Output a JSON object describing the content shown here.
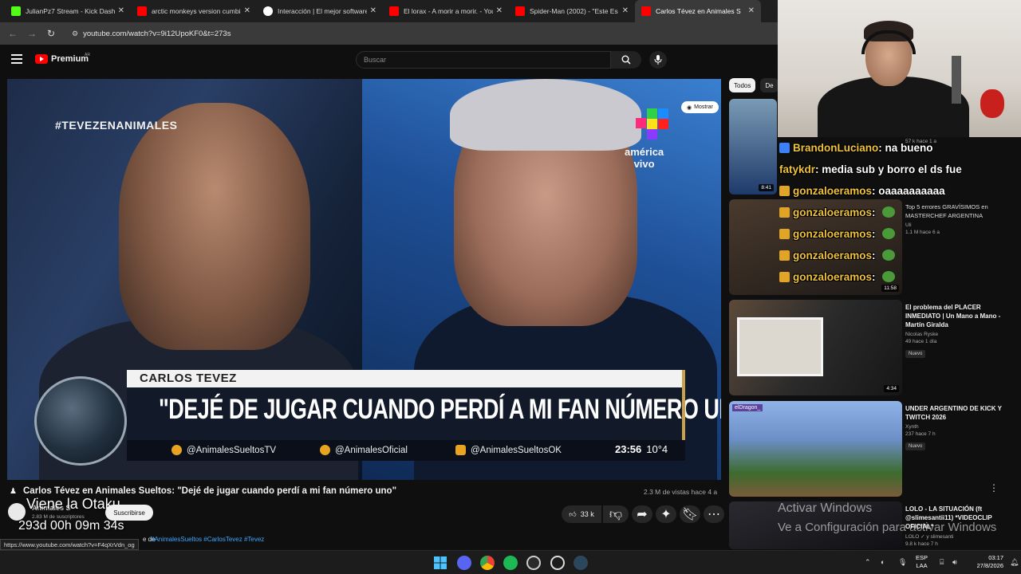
{
  "browser": {
    "tabs": [
      {
        "title": "JulianPz7 Stream - Kick Dashbo",
        "favicon_color": "#53fc18",
        "active": false
      },
      {
        "title": "arctic monkeys version cumbia",
        "favicon_color": "#ff0000",
        "active": false
      },
      {
        "title": "Interacción | El mejor software",
        "favicon_color": "#ffffff",
        "active": false
      },
      {
        "title": "El lorax - A morir a morir. - You",
        "favicon_color": "#ff0000",
        "active": false
      },
      {
        "title": "Spider-Man (2002) - \"Este Es M",
        "favicon_color": "#ff0000",
        "active": false
      },
      {
        "title": "Carlos Tévez en Animales S",
        "favicon_color": "#ff0000",
        "active": true
      }
    ],
    "url": "youtube.com/watch?v=9i12UpoKF0&t=273s"
  },
  "youtube": {
    "brand": "Premium",
    "region": "AR",
    "search_placeholder": "Buscar"
  },
  "video": {
    "hashtag": "#TEVEZENANIMALES",
    "channel_overlay": "américa\nvivo",
    "mostrar_label": "Mostrar",
    "lower_third": {
      "name": "CARLOS TEVEZ",
      "quote": "\"DEJÉ DE JUGAR CUANDO PERDÍ A MI FAN NÚMERO UNO\"",
      "socials": [
        "@AnimalesSueltosTV",
        "@AnimalesOficial",
        "@AnimalesSueltosOK"
      ],
      "time": "23:56",
      "temp": "10°4"
    },
    "title": "Carlos Tévez en Animales Sueltos: \"Dejé de jugar cuando perdí a mi fan número uno\"",
    "meta": "2.3 M de vistas  hace 4 a",
    "channel": "Animales S",
    "subs": "2.83 M de suscriptores",
    "subscribe_label": "Suscribirse",
    "likes": "33 k",
    "desc_prefix": "e de",
    "desc_tags": "#AnimalesSueltos #CarlosTevez #Tevez"
  },
  "stream_overlay": {
    "otaku_text": "Viene la Otaku",
    "timer": "293d 00h 09m 34s"
  },
  "status_url": "https://www.youtube.com/watch?v=F4qXrVdn_og",
  "sidebar": {
    "chips": [
      "Todos",
      "De"
    ],
    "recommendations": [
      {
        "title": "",
        "channel": "",
        "meta": "57 k  hace 1 a",
        "duration": "8:41",
        "badge": ""
      },
      {
        "title": "Top 5 errores GRAVÍSIMOS en MASTERCHEF ARGENTINA",
        "channel": "Uli",
        "meta": "1.1 M  hace 6 a",
        "duration": "11:58",
        "badge": ""
      },
      {
        "title": "El problema del PLACER INMEDIATO | Un Mano a Mano - Martín Giralda",
        "channel": "Nicolas Ryske",
        "meta": "49  hace 1 día",
        "duration": "4:34",
        "badge": "Nuevo"
      },
      {
        "title": "UNDER ARGENTINO DE KICK Y TWITCH 2026",
        "channel": "Xynth",
        "meta": "237  hace 7 h",
        "duration": "",
        "badge": "Nuevo",
        "thumb_tag": "elDragon_"
      },
      {
        "title": "LOLO - LA SITUACIÓN (ft @slimesantii11) *VIDEOCLIP OFICIAL*",
        "channel": "LOLO ✓ y slimesanti",
        "meta": "9.8 k  hace 7 h",
        "duration": "",
        "badge": ""
      }
    ]
  },
  "chat": [
    {
      "user": "BrandonLuciano",
      "message": ": na bueno",
      "user_color": "#f0c23c",
      "badge_color": "#3b82f6"
    },
    {
      "user": "fatykdr",
      "message": ": media sub y borro el ds fue",
      "user_color": "#f0c23c",
      "badge_color": ""
    },
    {
      "user": "gonzaloeramos",
      "message": ": oaaaaaaaaaa",
      "user_color": "#f0c23c",
      "badge_color": "#e0a526"
    },
    {
      "user": "gonzaloeramos",
      "message": ":",
      "user_color": "#f0c23c",
      "badge_color": "#e0a526"
    },
    {
      "user": "gonzaloeramos",
      "message": ":",
      "user_color": "#f0c23c",
      "badge_color": "#e0a526"
    },
    {
      "user": "gonzaloeramos",
      "message": ":",
      "user_color": "#f0c23c",
      "badge_color": "#e0a526"
    },
    {
      "user": "gonzaloeramos",
      "message": ":",
      "user_color": "#f0c23c",
      "badge_color": "#e0a526"
    }
  ],
  "windows": {
    "watermark_line1": "Activar Windows",
    "watermark_line2": "Ve a Configuración para activar Windows",
    "lang": "ESP\nLAA",
    "time": "03:17",
    "date": "27/8/2026"
  }
}
